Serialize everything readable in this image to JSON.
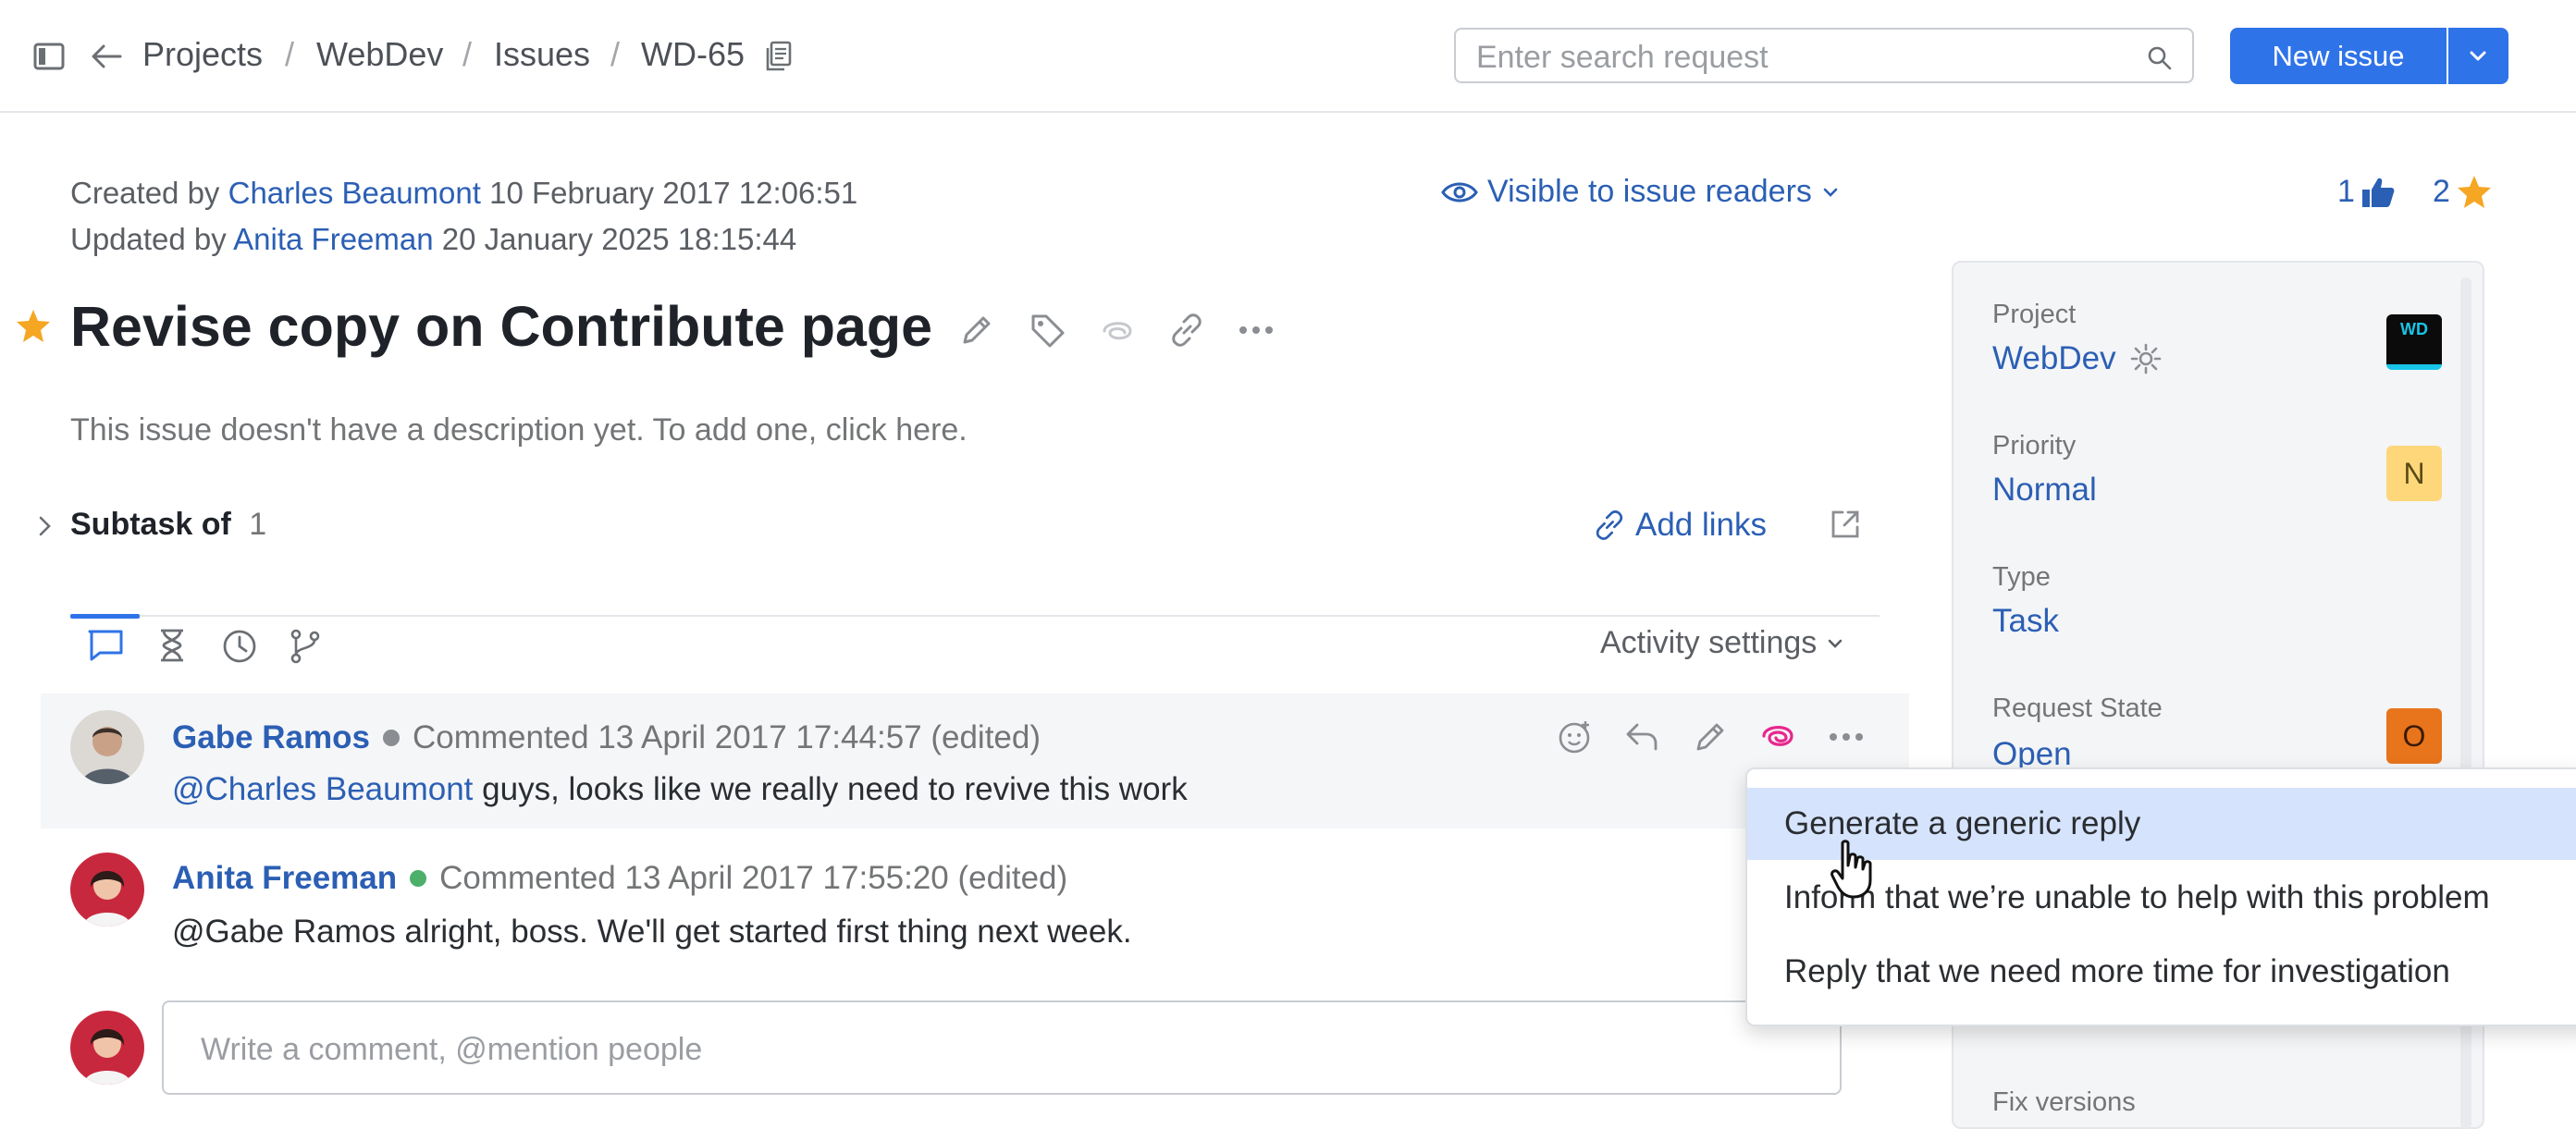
{
  "header": {
    "breadcrumbs": [
      "Projects",
      "WebDev",
      "Issues",
      "WD-65"
    ],
    "search_placeholder": "Enter search request",
    "new_issue_label": "New issue"
  },
  "issue": {
    "created_prefix": "Created by",
    "created_by": "Charles Beaumont",
    "created_at": "10 February 2017 12:06:51",
    "updated_prefix": "Updated by",
    "updated_by": "Anita Freeman",
    "updated_at": "20 January 2025 18:15:44",
    "visibility": "Visible to issue readers",
    "likes": "1",
    "stars": "2",
    "title": "Revise copy on Contribute page",
    "description": "This issue doesn't have a description yet. To add one, click here.",
    "subtask_label": "Subtask of",
    "subtask_count": "1",
    "add_links": "Add links"
  },
  "activity": {
    "settings_label": "Activity settings",
    "comment_placeholder": "Write a comment, @mention people",
    "comments": [
      {
        "author": "Gabe Ramos",
        "meta": "Commented 13 April 2017 17:44:57 (edited)",
        "mention": "@Charles Beaumont",
        "text": " guys, looks like we really need to revive this work",
        "status_color": "#8a8d91"
      },
      {
        "author": "Anita Freeman",
        "meta": "Commented 13 April 2017 17:55:20 (edited)",
        "text": "@Gabe Ramos alright, boss. We'll get started first thing next week.",
        "status_color": "#4caf6a"
      }
    ]
  },
  "menu": {
    "items": [
      "Generate a generic reply",
      "Inform that we’re unable to help with this problem",
      "Reply that we need more time for investigation"
    ]
  },
  "panel": {
    "project_label": "Project",
    "project_value": "WebDev",
    "project_badge": "WD",
    "priority_label": "Priority",
    "priority_value": "Normal",
    "priority_badge": "N",
    "type_label": "Type",
    "type_value": "Task",
    "state_label": "Request State",
    "state_value": "Open",
    "state_badge": "O",
    "fix_label": "Fix versions"
  },
  "colors": {
    "accent": "#2f73e8",
    "link": "#2b5fb4",
    "star": "#f5a623",
    "priority_badge": "#fdd77a",
    "state_badge": "#e8741c",
    "ai_icon": "#e8268e"
  }
}
